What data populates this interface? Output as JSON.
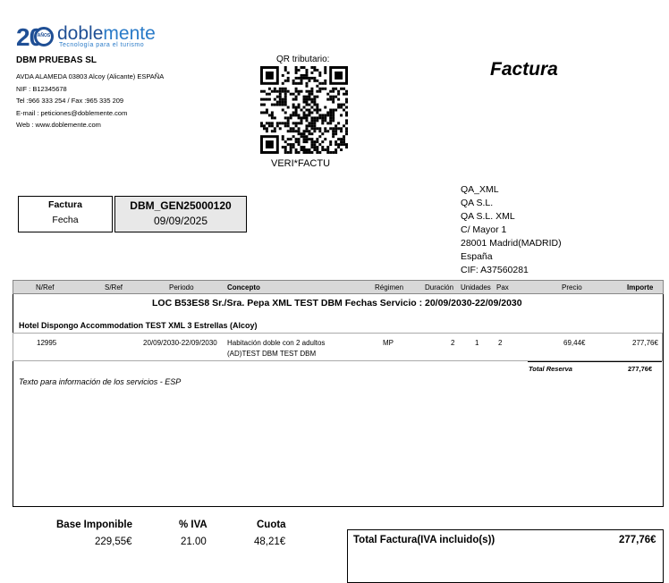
{
  "logo": {
    "num": "20",
    "years": "AÑOS",
    "brand_a": "doble",
    "brand_b": "mente",
    "tagline": "Tecnología para el turismo"
  },
  "company": {
    "name": "DBM PRUEBAS SL",
    "address": "AVDA ALAMEDA 03803 Alcoy (Alicante) ESPAÑA",
    "nif": "NIF : B12345678",
    "tel": "Tel :966 333 254 / Fax :965 335 209",
    "email": "E-mail  : peticiones@doblemente.com",
    "web": "Web : www.doblemente.com"
  },
  "qr": {
    "label": "QR tributario:",
    "footer": "VERI*FACTU"
  },
  "title": "Factura",
  "invoice": {
    "label_factura": "Factura",
    "label_fecha": "Fecha",
    "number": "DBM_GEN25000120",
    "date": "09/09/2025"
  },
  "client": {
    "l1": "QA_XML",
    "l2": "QA S.L.",
    "l3": "QA S.L. XML",
    "l4": "C/ Mayor 1",
    "l5": "28001  Madrid(MADRID)",
    "l6": "España",
    "l7": "CIF: A37560281"
  },
  "table": {
    "headers": {
      "nref": "N/Ref",
      "sref": "S/Ref",
      "periodo": "Periodo",
      "concepto": "Concepto",
      "regimen": "Régimen",
      "duracion": "Duración",
      "unidades": "Unidades",
      "pax": "Pax",
      "precio": "Precio",
      "importe": "Importe"
    },
    "loc": "LOC  B53ES8  Sr./Sra.  Pepa XML TEST DBM  Fechas Servicio : 20/09/2030-22/09/2030",
    "hotel": "Hotel Dispongo Accommodation TEST XML 3 Estrellas  (Alcoy)",
    "row": {
      "nref": "12995",
      "periodo": "20/09/2030-22/09/2030",
      "concepto1": "Habitación doble con 2 adultos",
      "concepto2": "(AD)TEST DBM TEST DBM",
      "regimen": "MP",
      "duracion": "2",
      "unidades": "1",
      "pax": "2",
      "precio": "69,44€",
      "importe": "277,76€"
    },
    "total_reserva_label": "Total Reserva",
    "total_reserva": "277,76€",
    "info_text": "Texto para información de los servicios - ESP"
  },
  "totals": {
    "base_label": "Base Imponible",
    "base": "229,55€",
    "iva_label": "% IVA",
    "iva": "21.00",
    "cuota_label": "Cuota",
    "cuota": "48,21€",
    "total_label": "Total Factura(IVA incluido(s))",
    "total": "277,76€"
  }
}
